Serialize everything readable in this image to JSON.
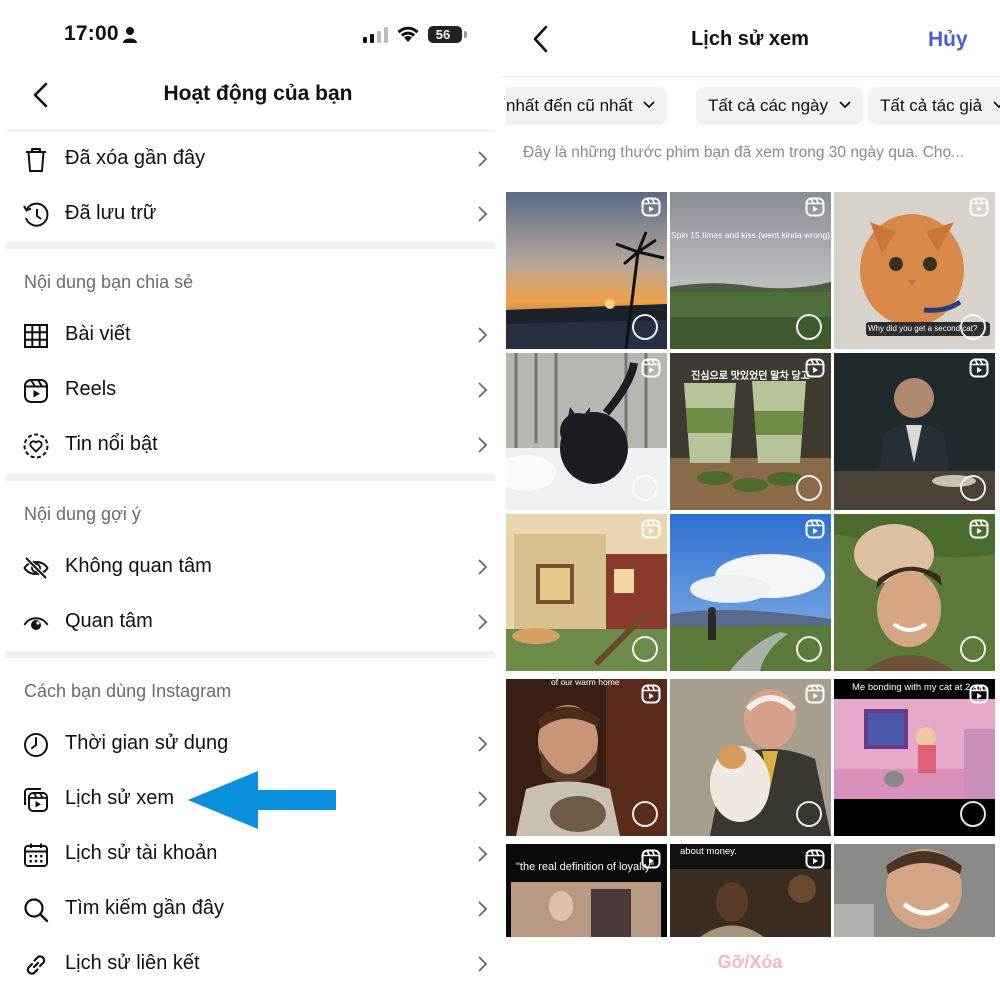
{
  "status_bar": {
    "time": "17:00",
    "battery": "56"
  },
  "left": {
    "title": "Hoạt động của bạn",
    "items_top": [
      {
        "label": "Đã xóa gần đây",
        "icon": "trash-icon"
      },
      {
        "label": "Đã lưu trữ",
        "icon": "archive-clock-icon"
      }
    ],
    "section_shared": {
      "title": "Nội dung bạn chia sẻ",
      "items": [
        {
          "label": "Bài viết",
          "icon": "grid-icon"
        },
        {
          "label": "Reels",
          "icon": "reels-icon"
        },
        {
          "label": "Tin nổi bật",
          "icon": "highlight-heart-icon"
        }
      ]
    },
    "section_suggested": {
      "title": "Nội dung gợi ý",
      "items": [
        {
          "label": "Không quan tâm",
          "icon": "eye-off-icon"
        },
        {
          "label": "Quan tâm",
          "icon": "eye-icon"
        }
      ]
    },
    "section_usage": {
      "title": "Cách bạn dùng Instagram",
      "items": [
        {
          "label": "Thời gian sử dụng",
          "icon": "clock-icon"
        },
        {
          "label": "Lịch sử xem",
          "icon": "watch-history-icon"
        },
        {
          "label": "Lịch sử tài khoản",
          "icon": "calendar-icon"
        },
        {
          "label": "Tìm kiếm gần đây",
          "icon": "search-icon"
        },
        {
          "label": "Lịch sử liên kết",
          "icon": "link-icon"
        }
      ]
    }
  },
  "right": {
    "title": "Lịch sử xem",
    "cancel": "Hủy",
    "filters": [
      "nhất đến cũ nhất",
      "Tất cả các ngày",
      "Tất cả tác giả"
    ],
    "description": "Đây là những thước phim bạn đã xem trong 30 ngày qua. Chọ...",
    "tiles": [
      {
        "name": "sunset-palm-reel",
        "caption": ""
      },
      {
        "name": "field-reel",
        "caption": "Spin 15 times and kiss (went kinda wrong)"
      },
      {
        "name": "orange-kitten-reel",
        "caption": "Why did you get a second cat?"
      },
      {
        "name": "black-cat-snow-reel",
        "caption": ""
      },
      {
        "name": "matcha-drinks-reel",
        "caption": "진심으로 맛있었던 말차 당고"
      },
      {
        "name": "dinner-scene-reel",
        "caption": ""
      },
      {
        "name": "cozy-house-illustration-reel",
        "caption": ""
      },
      {
        "name": "blue-sky-road-reel",
        "caption": ""
      },
      {
        "name": "man-with-cat-selfie-reel",
        "caption": ""
      },
      {
        "name": "bearded-man-cat-reel",
        "caption": "of our warm home"
      },
      {
        "name": "man-holding-cat-reel",
        "caption": ""
      },
      {
        "name": "cartoon-room-reel",
        "caption": "Me bonding with my cat at 2 am"
      },
      {
        "name": "loyalty-movie-reel",
        "caption": "\"the real definition of loyalty\""
      },
      {
        "name": "money-scene-reel",
        "caption": "about money."
      },
      {
        "name": "laughing-man-reel",
        "caption": ""
      }
    ],
    "remove_button": "Gỡ/Xóa"
  },
  "colors": {
    "accent_blue": "#4f5bd5",
    "arrow_blue": "#0a8fdc",
    "remove_pink": "#f4b6c0"
  }
}
